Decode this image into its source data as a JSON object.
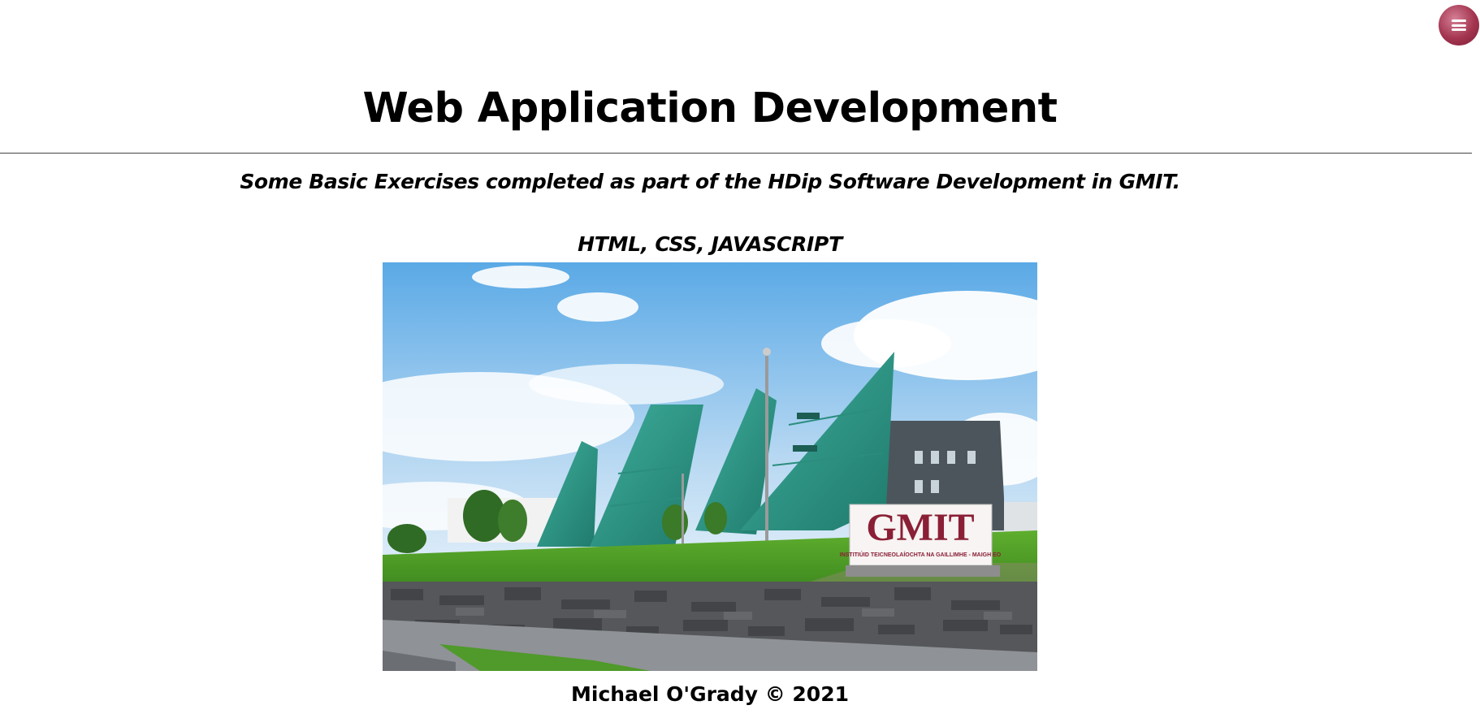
{
  "menu": {
    "icon": "hamburger-menu-icon"
  },
  "header": {
    "title": "Web Application Development",
    "subtitle": "Some Basic Exercises completed as part of the HDip Software Development in GMIT.",
    "technologies": "HTML, CSS, JAVASCRIPT"
  },
  "photo": {
    "sign_text": "GMIT",
    "sign_subtext": "INSTITIÚID TEICNEOLAÍOCHTA NA GAILLIMHE - MAIGH EO"
  },
  "footer": {
    "text": "Michael O'Grady © 2021"
  },
  "colors": {
    "menu_button": "#a3344f",
    "sign_text": "#8a1f35",
    "divider": "#444444"
  }
}
